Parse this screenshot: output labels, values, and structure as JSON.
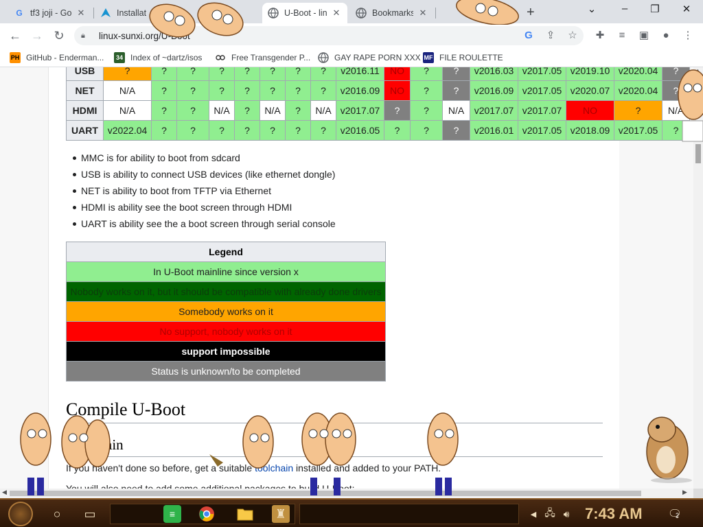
{
  "tabs": [
    {
      "title": "tf3 joji - Go",
      "favicon": "google-icon",
      "active": false
    },
    {
      "title": "Installat",
      "favicon": "arch-icon",
      "active": false
    },
    {
      "title": "",
      "favicon": "",
      "active": false
    },
    {
      "title": "U-Boot - lin",
      "favicon": "globe-icon",
      "active": true
    },
    {
      "title": "Bookmarks",
      "favicon": "globe-icon",
      "active": false
    },
    {
      "title": "",
      "favicon": "",
      "active": false
    }
  ],
  "address": {
    "url": "linux-sunxi.org/U-Boot"
  },
  "bookmarks": [
    {
      "label": "GitHub - Enderman...",
      "icon": "PH"
    },
    {
      "label": "Index of ~dartz/isos",
      "icon": "34"
    },
    {
      "label": "Free Transgender P...",
      "icon": "glasses"
    },
    {
      "label": "GAY RAPE PORN XXX",
      "icon": "globe"
    },
    {
      "label": "FILE ROULETTE",
      "icon": "MF"
    }
  ],
  "compat_table": {
    "rows": [
      {
        "header": "USB",
        "cells": [
          {
            "v": "?",
            "c": "c-orange",
            "w": 70
          },
          {
            "v": "?",
            "c": "c-green",
            "w": 37
          },
          {
            "v": "?",
            "c": "c-green",
            "w": 47
          },
          {
            "v": "?",
            "c": "c-green",
            "w": 37
          },
          {
            "v": "?",
            "c": "c-green",
            "w": 37
          },
          {
            "v": "?",
            "c": "c-green",
            "w": 37
          },
          {
            "v": "?",
            "c": "c-green",
            "w": 37
          },
          {
            "v": "?",
            "c": "c-green",
            "w": 37
          },
          {
            "v": "v2016.11",
            "c": "c-green",
            "w": 70
          },
          {
            "v": "NO",
            "c": "c-red",
            "w": 38
          },
          {
            "v": "?",
            "c": "c-green",
            "w": 47
          },
          {
            "v": "?",
            "c": "c-gray",
            "w": 40
          },
          {
            "v": "v2016.03",
            "c": "c-green",
            "w": 70
          },
          {
            "v": "v2017.05",
            "c": "c-green",
            "w": 70
          },
          {
            "v": "v2019.10",
            "c": "c-green",
            "w": 70
          },
          {
            "v": "v2020.04",
            "c": "c-green",
            "w": 70
          },
          {
            "v": "?",
            "c": "c-gray",
            "w": 40
          }
        ]
      },
      {
        "header": "NET",
        "cells": [
          {
            "v": "N/A",
            "c": "c-white",
            "w": 70
          },
          {
            "v": "?",
            "c": "c-green",
            "w": 37
          },
          {
            "v": "?",
            "c": "c-green",
            "w": 47
          },
          {
            "v": "?",
            "c": "c-green",
            "w": 37
          },
          {
            "v": "?",
            "c": "c-green",
            "w": 37
          },
          {
            "v": "?",
            "c": "c-green",
            "w": 37
          },
          {
            "v": "?",
            "c": "c-green",
            "w": 37
          },
          {
            "v": "?",
            "c": "c-green",
            "w": 37
          },
          {
            "v": "v2016.09",
            "c": "c-green",
            "w": 70
          },
          {
            "v": "NO",
            "c": "c-red",
            "w": 38
          },
          {
            "v": "?",
            "c": "c-green",
            "w": 47
          },
          {
            "v": "?",
            "c": "c-gray",
            "w": 40
          },
          {
            "v": "v2016.09",
            "c": "c-green",
            "w": 70
          },
          {
            "v": "v2017.05",
            "c": "c-green",
            "w": 70
          },
          {
            "v": "v2020.07",
            "c": "c-green",
            "w": 70
          },
          {
            "v": "v2020.04",
            "c": "c-green",
            "w": 70
          },
          {
            "v": "?",
            "c": "c-gray",
            "w": 40
          }
        ]
      },
      {
        "header": "HDMI",
        "cells": [
          {
            "v": "N/A",
            "c": "c-white",
            "w": 70
          },
          {
            "v": "?",
            "c": "c-green",
            "w": 37
          },
          {
            "v": "?",
            "c": "c-green",
            "w": 47
          },
          {
            "v": "N/A",
            "c": "c-white",
            "w": 37
          },
          {
            "v": "?",
            "c": "c-green",
            "w": 37
          },
          {
            "v": "N/A",
            "c": "c-white",
            "w": 37
          },
          {
            "v": "?",
            "c": "c-green",
            "w": 37
          },
          {
            "v": "N/A",
            "c": "c-white",
            "w": 37
          },
          {
            "v": "v2017.07",
            "c": "c-green",
            "w": 70
          },
          {
            "v": "?",
            "c": "c-gray",
            "w": 38
          },
          {
            "v": "?",
            "c": "c-green",
            "w": 47
          },
          {
            "v": "N/A",
            "c": "c-white",
            "w": 40
          },
          {
            "v": "v2017.07",
            "c": "c-green",
            "w": 70
          },
          {
            "v": "v2017.07",
            "c": "c-green",
            "w": 70
          },
          {
            "v": "NO",
            "c": "c-red",
            "w": 70
          },
          {
            "v": "?",
            "c": "c-orange",
            "w": 70
          },
          {
            "v": "N/A",
            "c": "c-white",
            "w": 40
          }
        ]
      },
      {
        "header": "UART",
        "cells": [
          {
            "v": "v2022.04",
            "c": "c-green",
            "w": 70
          },
          {
            "v": "?",
            "c": "c-green",
            "w": 37
          },
          {
            "v": "?",
            "c": "c-green",
            "w": 47
          },
          {
            "v": "?",
            "c": "c-green",
            "w": 37
          },
          {
            "v": "?",
            "c": "c-green",
            "w": 37
          },
          {
            "v": "?",
            "c": "c-green",
            "w": 37
          },
          {
            "v": "?",
            "c": "c-green",
            "w": 37
          },
          {
            "v": "?",
            "c": "c-green",
            "w": 37
          },
          {
            "v": "v2016.05",
            "c": "c-green",
            "w": 70
          },
          {
            "v": "?",
            "c": "c-green",
            "w": 38
          },
          {
            "v": "?",
            "c": "c-green",
            "w": 47
          },
          {
            "v": "?",
            "c": "c-gray",
            "w": 40
          },
          {
            "v": "v2016.01",
            "c": "c-green",
            "w": 70
          },
          {
            "v": "v2017.05",
            "c": "c-green",
            "w": 70
          },
          {
            "v": "v2018.09",
            "c": "c-green",
            "w": 70
          },
          {
            "v": "v2017.05",
            "c": "c-green",
            "w": 70
          },
          {
            "v": "?",
            "c": "c-green",
            "w": 40
          }
        ]
      }
    ]
  },
  "usage_list": [
    "MMC is for ability to boot from sdcard",
    "USB is ability to connect USB devices (like ethernet dongle)",
    "NET is ability to boot from TFTP via Ethernet",
    "HDMI is ability see the boot screen through HDMI",
    "UART is ability see the a boot screen through serial console"
  ],
  "legend": {
    "title": "Legend",
    "rows": [
      {
        "label": "In U-Boot mainline since version x",
        "cls": "lg-green"
      },
      {
        "label": "Nobody works on it, but it should be compatible with already done drivers",
        "cls": "lg-dark"
      },
      {
        "label": "Somebody works on it",
        "cls": "lg-orange"
      },
      {
        "label": "No support, nobody works on it",
        "cls": "lg-red"
      },
      {
        "label": "support impossible",
        "cls": "lg-black"
      },
      {
        "label": "Status is unknown/to be completed",
        "cls": "lg-gray"
      }
    ]
  },
  "headings": {
    "compile": "Compile U-Boot",
    "toolchain": "Toolchain"
  },
  "paragraphs": {
    "p1_before": "If you haven't done so before, get a suitable ",
    "p1_link": "toolchain",
    "p1_after": " installed and added to your PATH.",
    "p2": "You will also need to add some additional packages to build U-Boot:"
  },
  "taskbar": {
    "clock": "7:43 AM",
    "notifications": "2"
  },
  "colors": {
    "accent_green": "#90ee90",
    "tab_strip": "#dee1e6",
    "taskbar": "#2b1607"
  }
}
